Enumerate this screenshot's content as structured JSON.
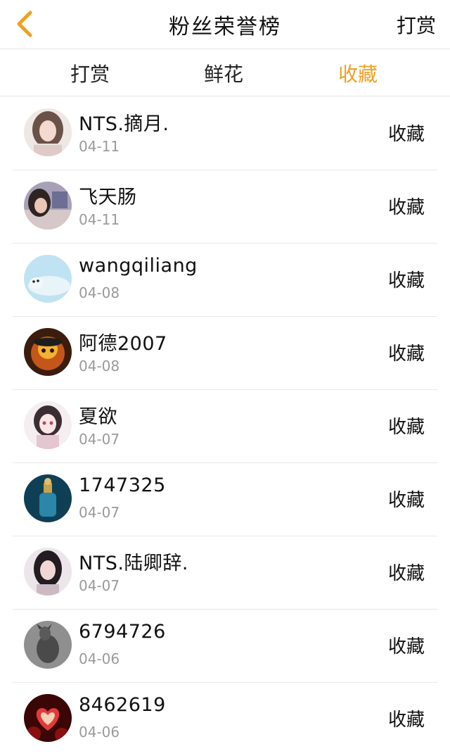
{
  "header": {
    "title": "粉丝荣誉榜",
    "right_label": "打赏",
    "back_icon": "chevron-left-icon",
    "back_icon_color": "#f0a020"
  },
  "tabs": [
    {
      "label": "打赏",
      "active": false
    },
    {
      "label": "鲜花",
      "active": false
    },
    {
      "label": "收藏",
      "active": true
    }
  ],
  "colors": {
    "accent": "#f0a020",
    "divider": "#e8e8e8",
    "date": "#9a9a9a"
  },
  "fans": [
    {
      "name": "NTS.摘月.",
      "date": "04-11",
      "action": "收藏",
      "avatar": "girl-portrait"
    },
    {
      "name": "飞天肠",
      "date": "04-11",
      "action": "收藏",
      "avatar": "girl-portrait"
    },
    {
      "name": "wangqiliang",
      "date": "04-08",
      "action": "收藏",
      "avatar": "seal-photo"
    },
    {
      "name": "阿德2007",
      "date": "04-08",
      "action": "收藏",
      "avatar": "game-character"
    },
    {
      "name": "夏欲",
      "date": "04-07",
      "action": "收藏",
      "avatar": "anime-girl"
    },
    {
      "name": "1747325",
      "date": "04-07",
      "action": "收藏",
      "avatar": "perfume-bottle"
    },
    {
      "name": "NTS.陆卿辞.",
      "date": "04-07",
      "action": "收藏",
      "avatar": "girl-portrait"
    },
    {
      "name": "6794726",
      "date": "04-06",
      "action": "收藏",
      "avatar": "metal-figurine"
    },
    {
      "name": "8462619",
      "date": "04-06",
      "action": "收藏",
      "avatar": "heart-roses"
    }
  ]
}
